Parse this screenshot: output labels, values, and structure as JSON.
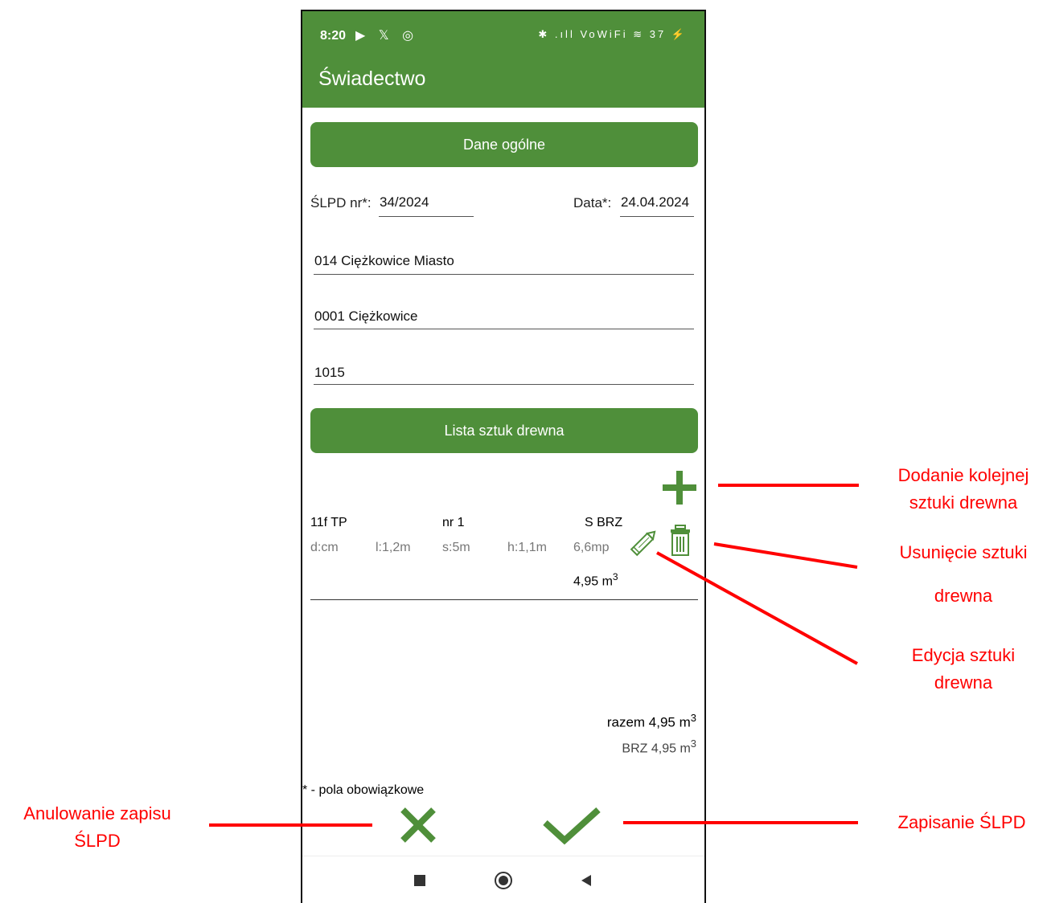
{
  "status_bar": {
    "time": "8:20",
    "left_icons": "▶ 𝕏 ◎",
    "right_icons": "✱ .ıll VoWiFi ≋ 37 ⚡"
  },
  "app_bar": {
    "title": "Świadectwo"
  },
  "section_general": {
    "label": "Dane ogólne"
  },
  "slpd": {
    "label": "ŚLPD nr*:",
    "value": "34/2024"
  },
  "date": {
    "label": "Data*:",
    "value": "24.04.2024"
  },
  "field_district": "014 Ciężkowice Miasto",
  "field_area": "0001 Ciężkowice",
  "field_number": "1015",
  "section_list": {
    "label": "Lista sztuk drewna"
  },
  "wood_item": {
    "code": "11f  TP",
    "nr": "nr 1",
    "species": "S  BRZ",
    "d": "d:cm",
    "l": "l:1,2m",
    "s": "s:5m",
    "h": "h:1,1m",
    "mp": "6,6mp",
    "volume": "4,95 m",
    "volume_exp": "3"
  },
  "totals": {
    "sum": "razem 4,95 m",
    "sum_exp": "3",
    "brz": "BRZ 4,95 m",
    "brz_exp": "3"
  },
  "required_note": "* - pola obowiązkowe",
  "annotations": {
    "add": [
      "Dodanie kolejnej",
      "sztuki drewna"
    ],
    "delete": [
      "Usunięcie sztuki",
      "drewna"
    ],
    "edit": [
      "Edycja sztuki",
      "drewna"
    ],
    "cancel": [
      "Anulowanie zapisu",
      "ŚLPD"
    ],
    "save": "Zapisanie ŚLPD"
  },
  "colors": {
    "green": "#4f8f3a",
    "annotation_red": "#ff0000"
  }
}
